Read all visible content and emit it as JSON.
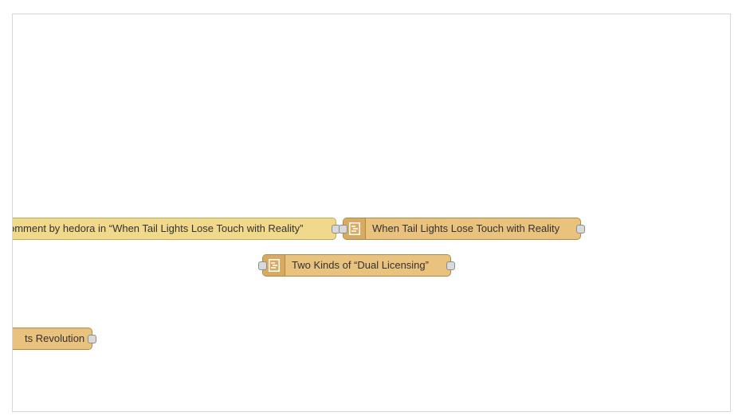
{
  "canvas": {
    "nodes": [
      {
        "id": "comment-node",
        "label": "omment by hedora in “When Tail Lights Lose Touch with Reality”",
        "type": "comment",
        "icon": "none"
      },
      {
        "id": "article-node-tail-lights",
        "label": "When Tail Lights Lose Touch with Reality",
        "type": "article",
        "icon": "document-list-icon"
      },
      {
        "id": "article-node-dual-licensing",
        "label": "Two Kinds of “Dual Licensing”",
        "type": "article",
        "icon": "document-list-icon"
      },
      {
        "id": "article-node-revolution",
        "label": "ts Revolution",
        "type": "article",
        "icon": "none"
      }
    ]
  },
  "colors": {
    "node_fill": "#e9c27d",
    "comment_fill": "#f0d98a",
    "node_border": "#b38a45",
    "port_fill": "#d9d9d9"
  }
}
